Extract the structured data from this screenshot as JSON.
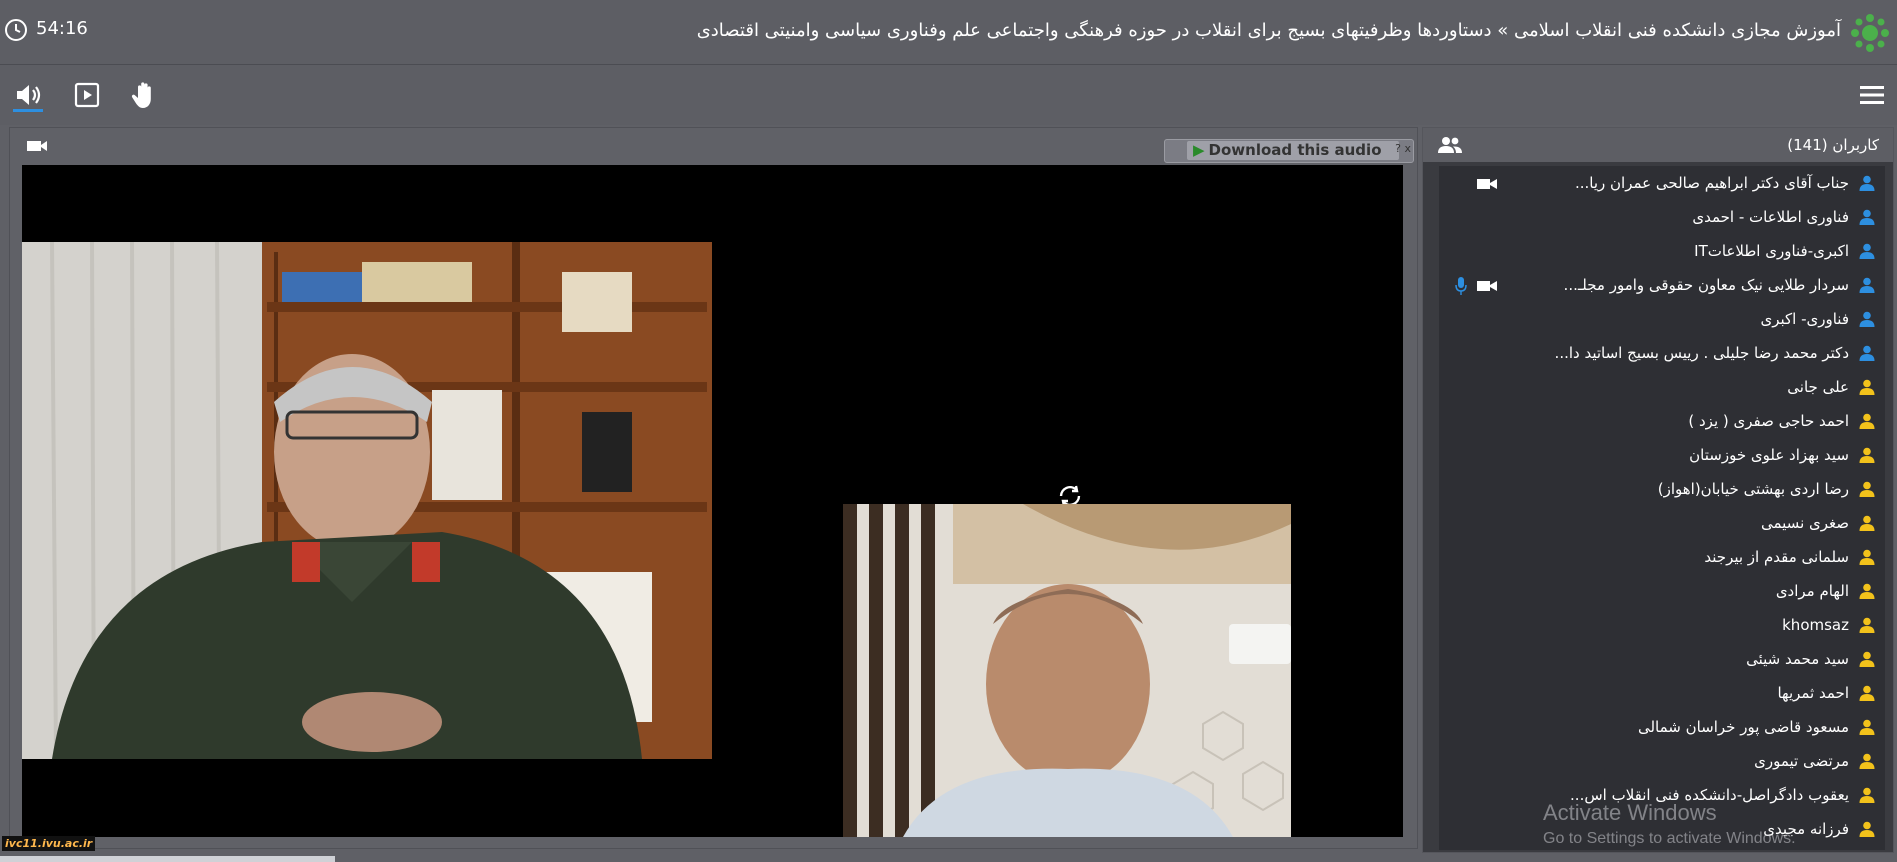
{
  "header": {
    "timer": "54:16",
    "title": "آموزش مجازی دانشکده فنی انقلاب اسلامی » دستاوردها وظرفیتهای بسیج برای انقلاب در حوزه فرهنگی واجتماعی علم وفناوری سیاسی وامنیتی اقتصادی"
  },
  "toolbar": {
    "icons": [
      "speaker-icon",
      "presentation-icon",
      "raise-hand-icon",
      "menu-icon"
    ]
  },
  "video": {
    "download_label": "Download this audio",
    "download_help": "?",
    "download_close": "x"
  },
  "users": {
    "title": "کاربران (141)",
    "list": [
      {
        "name": "جناب آقای دکتر ابراهیم صالحی عمران ریا...",
        "role": "presenter",
        "cam": true,
        "mic": false
      },
      {
        "name": "فناوری اطلاعات - احمدی",
        "role": "presenter",
        "cam": false,
        "mic": false
      },
      {
        "name": "اکبری-فناوری اطلاعاتIT",
        "role": "presenter",
        "cam": false,
        "mic": false
      },
      {
        "name": "سردار طلایی نیک معاون حقوقی وامور مجلـ...",
        "role": "presenter",
        "cam": true,
        "mic": true
      },
      {
        "name": "فناوری- اکبری",
        "role": "presenter",
        "cam": false,
        "mic": false
      },
      {
        "name": "دکتر محمد رضا جلیلی . رییس بسیج اساتید دا...",
        "role": "presenter",
        "cam": false,
        "mic": false
      },
      {
        "name": "علی جانی",
        "role": "participant",
        "cam": false,
        "mic": false
      },
      {
        "name": "احمد حاجی صفری ( یزد )",
        "role": "participant",
        "cam": false,
        "mic": false
      },
      {
        "name": "سید بهزاد علوی خوزستان",
        "role": "participant",
        "cam": false,
        "mic": false
      },
      {
        "name": "رضا اردی بهشتی خیابان(اهواز)",
        "role": "participant",
        "cam": false,
        "mic": false
      },
      {
        "name": "صغری نسیمی",
        "role": "participant",
        "cam": false,
        "mic": false
      },
      {
        "name": "سلمانی مقدم از بیرجند",
        "role": "participant",
        "cam": false,
        "mic": false
      },
      {
        "name": "الهام مرادی",
        "role": "participant",
        "cam": false,
        "mic": false
      },
      {
        "name": "khomsaz",
        "role": "participant",
        "cam": false,
        "mic": false
      },
      {
        "name": "سید محمد شیئی",
        "role": "participant",
        "cam": false,
        "mic": false
      },
      {
        "name": "احمد ثمریها",
        "role": "participant",
        "cam": false,
        "mic": false
      },
      {
        "name": "مسعود قاضی پور خراسان شمالی",
        "role": "participant",
        "cam": false,
        "mic": false
      },
      {
        "name": "مرتضی تیموری",
        "role": "participant",
        "cam": false,
        "mic": false
      },
      {
        "name": "یعقوب دادگراصل-دانشکده فنی انقلاب اس...",
        "role": "participant",
        "cam": false,
        "mic": false
      },
      {
        "name": "فرزانه مجیدی",
        "role": "participant",
        "cam": false,
        "mic": false
      }
    ]
  },
  "overlay": {
    "activate_title": "Activate Windows",
    "activate_sub": "Go to Settings to activate Windows.",
    "site": "ivc11.ivu.ac.ir"
  },
  "colors": {
    "presenter_icon": "#2d8fe0",
    "participant_icon": "#f2c21b",
    "accent": "#2d8fe0"
  }
}
